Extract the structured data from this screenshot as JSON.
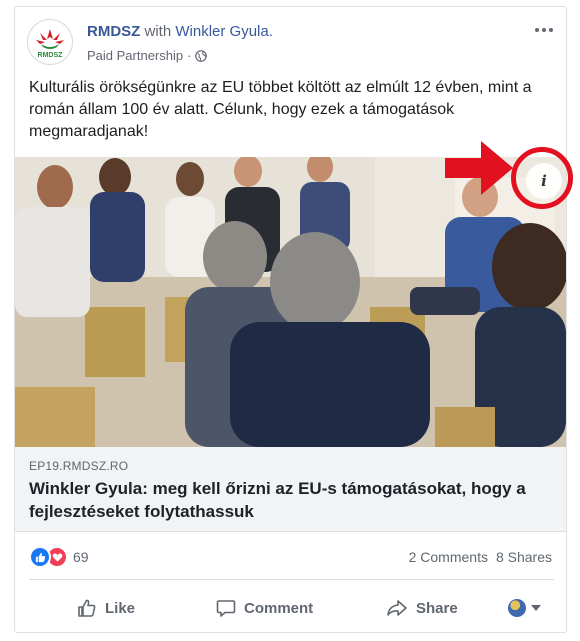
{
  "post": {
    "page_name": "RMDSZ",
    "with_text": "with",
    "tagged_person": "Winkler Gyula.",
    "subtitle": "Paid Partnership",
    "separator": "·",
    "avatar_text": "RMDSZ",
    "body_text": "Kulturális örökségünkre az EU többet költött az elmúlt 12 évben, mint a román állam 100 év alatt. Célunk, hogy ezek a támogatások megmaradjanak!"
  },
  "image": {
    "info_button_label": "i",
    "annotation_color": "#e3101f"
  },
  "link": {
    "domain": "EP19.RMDSZ.RO",
    "title": "Winkler Gyula: meg kell őrizni az EU-s támogatásokat, hogy a fejlesztéseket folytathassuk"
  },
  "stats": {
    "reaction_count": "69",
    "comments": "2 Comments",
    "shares": "8 Shares"
  },
  "actions": {
    "like": "Like",
    "comment": "Comment",
    "share": "Share"
  },
  "colors": {
    "link_blue": "#385898",
    "like_blue": "#1877f2",
    "love_red": "#f33e58",
    "brand_green": "#2a8a3e",
    "brand_red": "#d4202a"
  },
  "icons": {
    "globe": "globe-icon",
    "more": "more-icon",
    "info": "info-icon",
    "like": "thumbs-up-icon",
    "love": "heart-icon",
    "comment": "comment-bubble-icon",
    "share": "share-arrow-icon"
  }
}
